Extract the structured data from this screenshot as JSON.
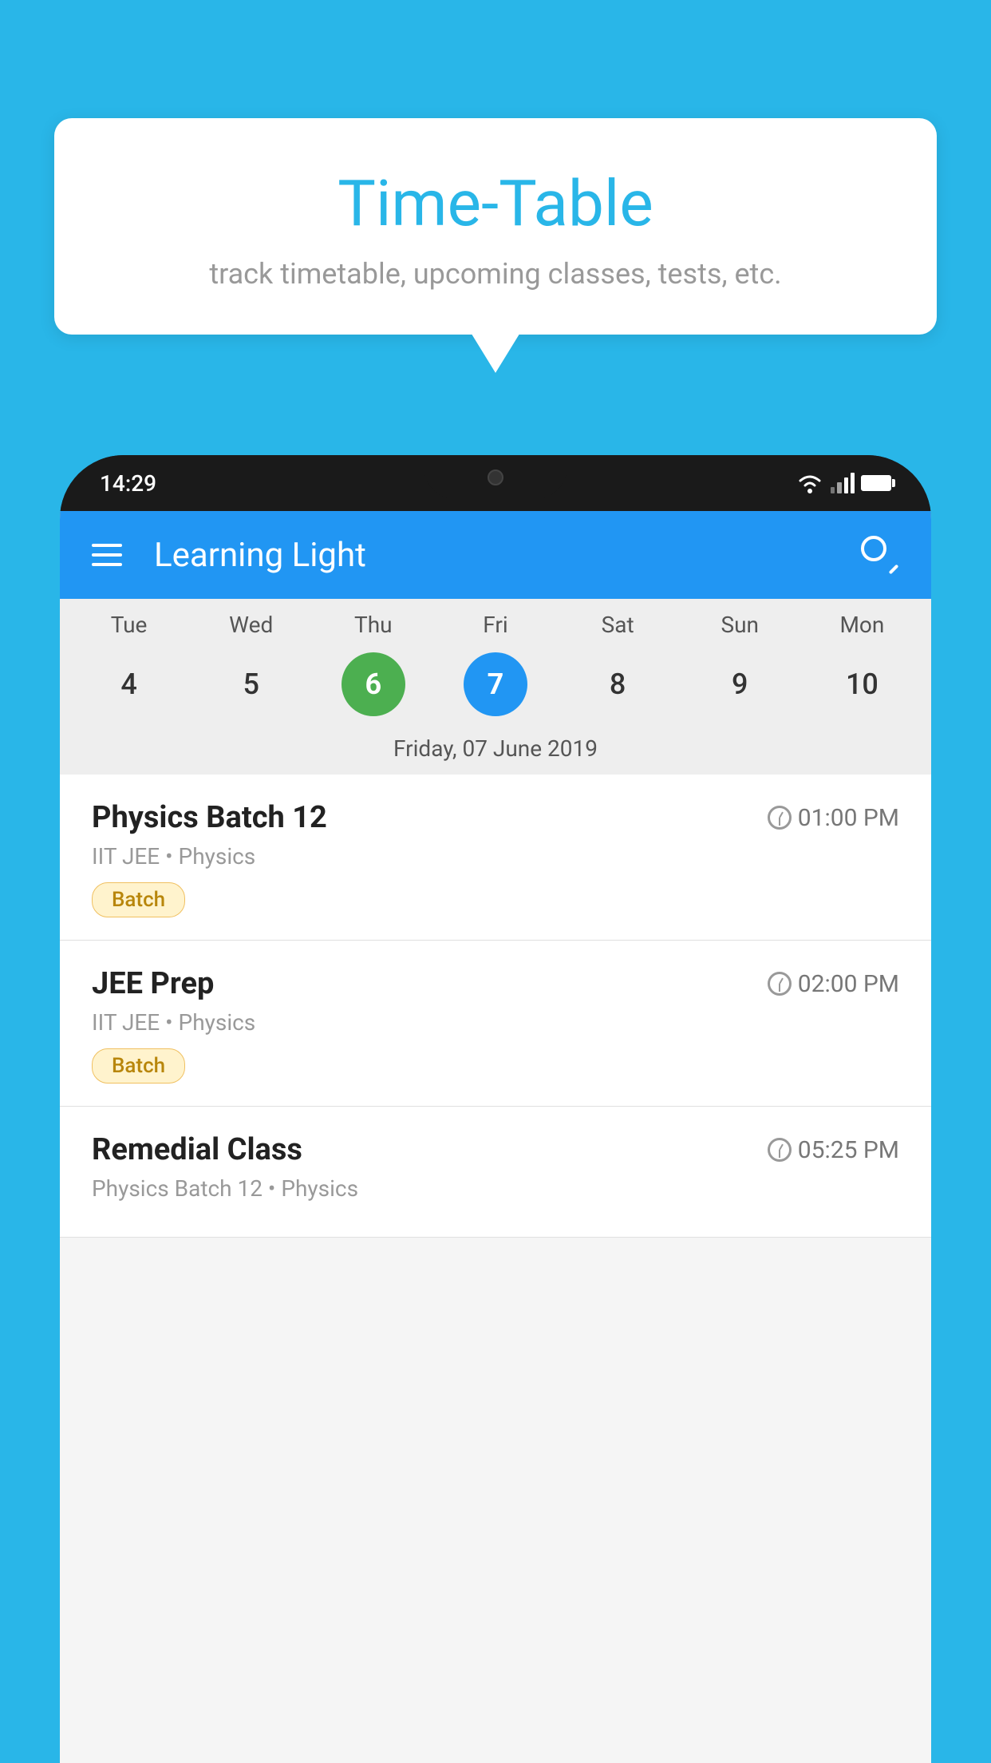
{
  "background_color": "#29b6e8",
  "speech_bubble": {
    "title": "Time-Table",
    "subtitle": "track timetable, upcoming classes, tests, etc."
  },
  "status_bar": {
    "time": "14:29"
  },
  "app": {
    "title": "Learning Light",
    "calendar": {
      "days_of_week": [
        "Tue",
        "Wed",
        "Thu",
        "Fri",
        "Sat",
        "Sun",
        "Mon"
      ],
      "day_numbers": [
        "4",
        "5",
        "6",
        "7",
        "8",
        "9",
        "10"
      ],
      "today_index": 2,
      "selected_index": 3,
      "selected_date_label": "Friday, 07 June 2019"
    },
    "schedule_items": [
      {
        "title": "Physics Batch 12",
        "time": "01:00 PM",
        "subtitle": "IIT JEE • Physics",
        "badge": "Batch"
      },
      {
        "title": "JEE Prep",
        "time": "02:00 PM",
        "subtitle": "IIT JEE • Physics",
        "badge": "Batch"
      },
      {
        "title": "Remedial Class",
        "time": "05:25 PM",
        "subtitle": "Physics Batch 12 • Physics",
        "badge": null
      }
    ]
  }
}
